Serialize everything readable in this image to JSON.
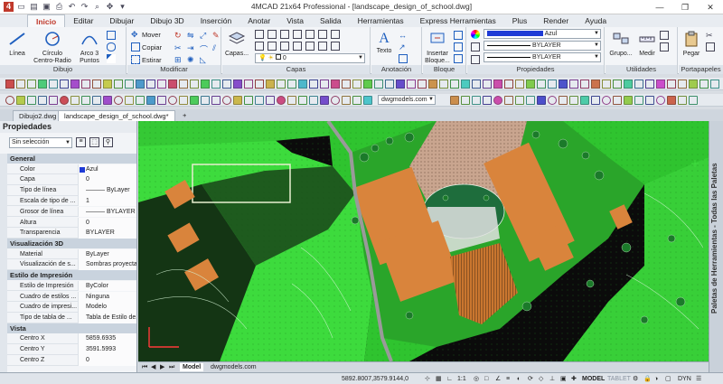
{
  "window": {
    "title": "4MCAD 21x64 Professional - [landscape_design_of_school.dwg]",
    "controls": [
      "—",
      "❐",
      "✕"
    ]
  },
  "menu": {
    "tabs": [
      "Inicio",
      "Editar",
      "Dibujar",
      "Dibujo 3D",
      "Inserción",
      "Anotar",
      "Vista",
      "Salida",
      "Herramientas",
      "Express Herramientas",
      "Plus",
      "Render",
      "Ayuda"
    ],
    "active": "Inicio"
  },
  "ribbon": {
    "dibujar": {
      "label": "Dibujo",
      "linea": "Línea",
      "circulo": "Círculo\nCentro-Radio",
      "arco": "Arco 3\nPuntos"
    },
    "modificar": {
      "label": "Modificar",
      "mover": "Mover",
      "copiar": "Copiar",
      "estirar": "Estirar"
    },
    "capas": {
      "label": "Capas",
      "btn": "Capas...",
      "current_layer": "0"
    },
    "anotacion": {
      "label": "Anotación",
      "texto": "Texto"
    },
    "bloque": {
      "label": "Bloque",
      "insertar": "Insertar\nBloque..."
    },
    "propiedades": {
      "label": "Propiedades",
      "color": "Azul",
      "linetype": "BYLAYER",
      "lineweight": "BYLAYER"
    },
    "utilidades": {
      "label": "Utilidades",
      "grupo": "Grupo...",
      "medir": "Medir"
    },
    "portapapeles": {
      "label": "Portapapeles",
      "pegar": "Pegar"
    }
  },
  "toolbar": {
    "site_combo": "dwgmodels.com"
  },
  "doc_tabs": [
    "Dibujo2.dwg",
    "landscape_design_of_school.dwg*",
    "+"
  ],
  "properties": {
    "title": "Propiedades",
    "selection": "Sin selección",
    "sections": [
      {
        "name": "General",
        "rows": [
          [
            "Color",
            "Azul"
          ],
          [
            "Capa",
            "0"
          ],
          [
            "Tipo de línea",
            "——— ByLayer"
          ],
          [
            "Escala de tipo de ...",
            "1"
          ],
          [
            "Grosor de línea",
            "——— BYLAYER"
          ],
          [
            "Altura",
            "0"
          ],
          [
            "Transparencia",
            "BYLAYER"
          ]
        ]
      },
      {
        "name": "Visualización 3D",
        "rows": [
          [
            "Material",
            "ByLayer"
          ],
          [
            "Visualización de s...",
            "Sombras proyecta..."
          ]
        ]
      },
      {
        "name": "Estilo de Impresión",
        "rows": [
          [
            "Estilo de Impresión",
            "ByColor"
          ],
          [
            "Cuadro de estilos ...",
            "Ninguna"
          ],
          [
            "Cuadro de impresi...",
            "Modelo"
          ],
          [
            "Tipo de tabla de ...",
            "Tabla de Estilo de..."
          ]
        ]
      },
      {
        "name": "Vista",
        "rows": [
          [
            "Centro X",
            "5859.6935"
          ],
          [
            "Centro Y",
            "3591.5993"
          ],
          [
            "Centro Z",
            "0"
          ]
        ]
      }
    ]
  },
  "palette": {
    "label": "Paletas de Herramientas - Todas las Paletas"
  },
  "layout_tabs": {
    "nav": [
      "⏮",
      "◀",
      "▶",
      "⏭"
    ],
    "model": "Model",
    "layout": "dwgmodels.com"
  },
  "status": {
    "coords": "5892.8007,3579.9144,0",
    "scale": "1:1",
    "model": "MODEL",
    "tablet": "TABLET",
    "dyn": "DYN"
  },
  "colors": {
    "accent": "#c0392b",
    "drawing_bg": "#0b0b0b",
    "terrain": "#3ddb3d",
    "roof": "#d9843c",
    "plaza": "#c9a58f",
    "layer_blue": "#1f3bd6"
  }
}
